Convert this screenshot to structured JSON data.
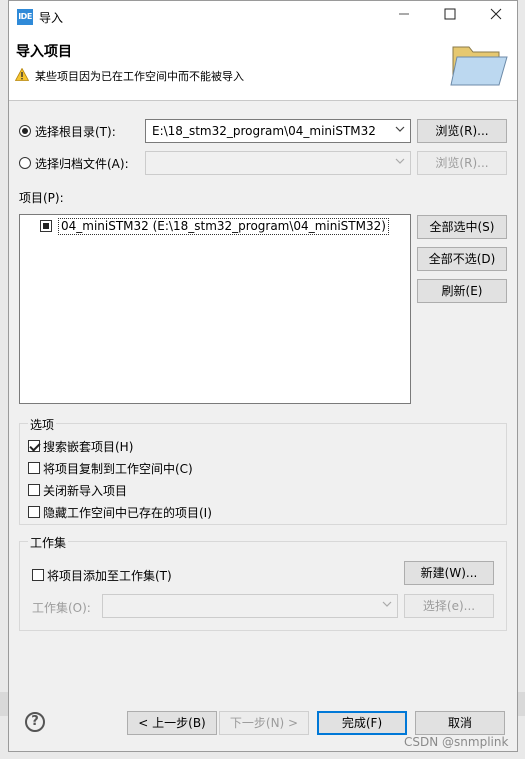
{
  "window": {
    "title": "导入",
    "icon_text": "IDE",
    "controls": [
      "minimize-icon",
      "maximize-icon",
      "close-icon"
    ]
  },
  "header": {
    "title": "导入项目",
    "message": "某些项目因为已在工作空间中而不能被导入",
    "message_icon": "warning-icon",
    "art_icon": "folder-icon"
  },
  "source": {
    "root_dir_label": "选择根目录(T):",
    "root_dir_selected": true,
    "root_dir_value": "E:\\18_stm32_program\\04_miniSTM32",
    "browse_label": "浏览(R)...",
    "archive_label": "选择归档文件(A):",
    "archive_selected": false,
    "archive_value": "",
    "archive_browse_label": "浏览(R)..."
  },
  "projects": {
    "label": "项目(P):",
    "items": [
      {
        "name": "04_miniSTM32  (E:\\18_stm32_program\\04_miniSTM32)",
        "state": "indeterminate"
      }
    ],
    "select_all": "全部选中(S)",
    "deselect_all": "全部不选(D)",
    "refresh": "刷新(E)"
  },
  "options": {
    "title": "选项",
    "items": [
      {
        "label": "搜索嵌套项目(H)",
        "checked": true
      },
      {
        "label": "将项目复制到工作空间中(C)",
        "checked": false
      },
      {
        "label": "关闭新导入项目",
        "checked": false
      },
      {
        "label": "隐藏工作空间中已存在的项目(I)",
        "checked": false
      }
    ]
  },
  "working_sets": {
    "title": "工作集",
    "add_label": "将项目添加至工作集(T)",
    "add_checked": false,
    "new_label": "新建(W)...",
    "set_label": "工作集(O):",
    "set_value": "",
    "select_label": "选择(e)..."
  },
  "footer": {
    "help_icon": "help-icon",
    "help_glyph": "?",
    "back": "< 上一步(B)",
    "next": "下一步(N) >",
    "finish": "完成(F)",
    "cancel": "取消"
  },
  "watermark": "CSDN @snmplink"
}
